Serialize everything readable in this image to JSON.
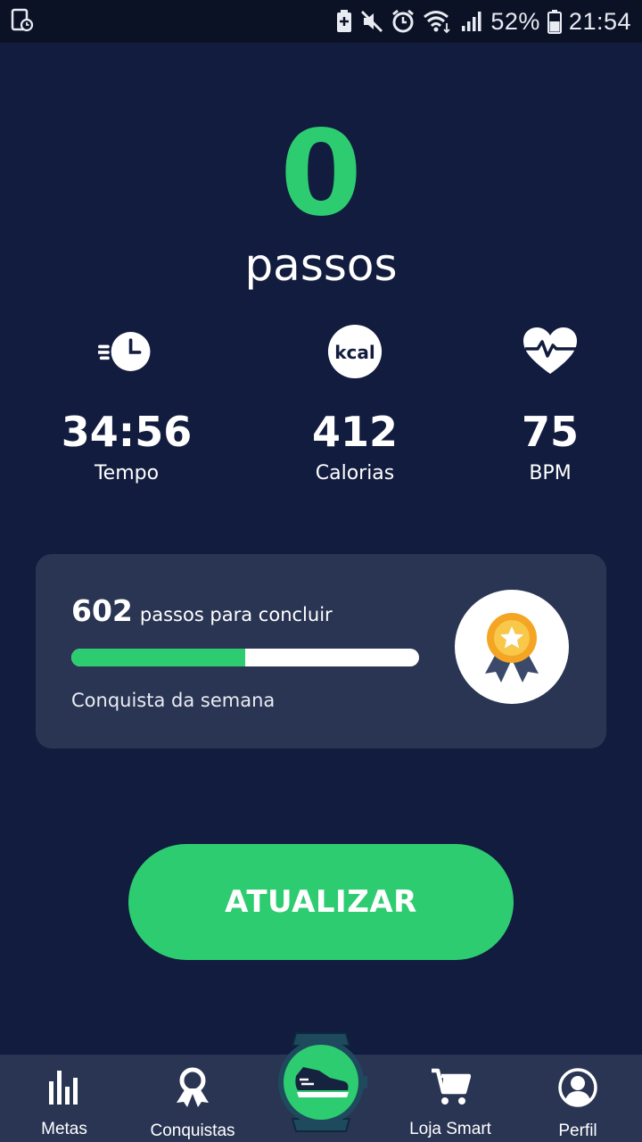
{
  "status_bar": {
    "battery_percent": "52%",
    "time": "21:54",
    "icons": [
      "screen-record-icon",
      "battery-saver-icon",
      "mute-icon",
      "alarm-icon",
      "wifi-icon",
      "signal-icon",
      "battery-icon"
    ]
  },
  "steps": {
    "count": "0",
    "label": "passos"
  },
  "stats": {
    "time": {
      "value": "34:56",
      "label": "Tempo",
      "icon": "clock-icon"
    },
    "calories": {
      "value": "412",
      "label": "Calorias",
      "icon": "kcal-icon",
      "icon_text": "kcal"
    },
    "bpm": {
      "value": "75",
      "label": "BPM",
      "icon": "heart-rate-icon"
    }
  },
  "achievement": {
    "remaining": "602",
    "remaining_text": "passos para concluir",
    "progress": 0.5,
    "subtitle": "Conquista da semana",
    "icon": "medal-icon"
  },
  "update_button": {
    "label": "ATUALIZAR"
  },
  "nav": {
    "items": [
      {
        "label": "Metas",
        "icon": "bar-chart-icon"
      },
      {
        "label": "Conquistas",
        "icon": "award-icon"
      },
      {
        "label": "Loja Smart",
        "icon": "cart-icon"
      },
      {
        "label": "Perfil",
        "icon": "profile-icon"
      }
    ],
    "center_icon": "smartwatch-shoe-icon"
  },
  "colors": {
    "background": "#121c3e",
    "accent": "#2ecc71",
    "card": "#293553",
    "status_bar": "#0c1226"
  }
}
